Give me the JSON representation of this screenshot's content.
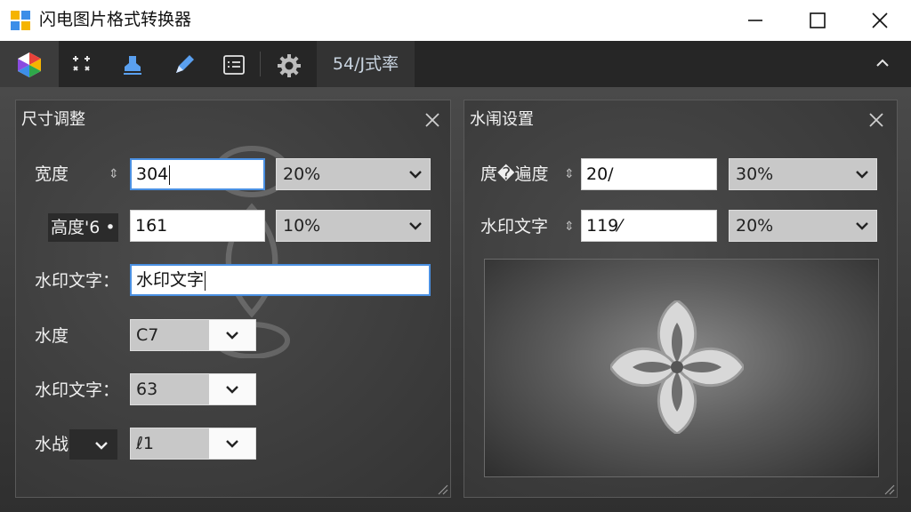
{
  "window": {
    "title": "闪电图片格式转换器"
  },
  "toolbar": {
    "zoom_label": "54/J式率",
    "tools": [
      "app-logo-icon",
      "resize-arrows-icon",
      "stamp-icon",
      "pencil-icon",
      "text-box-icon",
      "gear-icon"
    ]
  },
  "resize_panel": {
    "title": "尺寸调整",
    "width_label": "宽度",
    "width_spin": "⇕",
    "width_value": "304",
    "width_percent": "20%",
    "height_label": "高度",
    "height_overlay": "高度'6 •",
    "height_value": "161",
    "height_percent": "10%",
    "text_label": "水印文字：",
    "text_value": "水印文字",
    "row4_label": "水度",
    "row4_value": "C7",
    "row5_label": "水印文字：",
    "row5_value": "63",
    "row6_label": "水战庶",
    "row6_value": "ℓ1"
  },
  "watermark_panel": {
    "title": "水闱设置",
    "opacity_label": "庹�遍度",
    "opacity_spin": "⇕",
    "opacity_value": "20/",
    "opacity_percent": "30%",
    "text_label": "水印文字",
    "text_spin": "⇕",
    "text_value": "119⁄",
    "text_percent": "20%"
  },
  "colors": {
    "accent": "#4a90e2",
    "toolbar_bg": "#262626",
    "panel_bg": "#3f3f3f"
  }
}
